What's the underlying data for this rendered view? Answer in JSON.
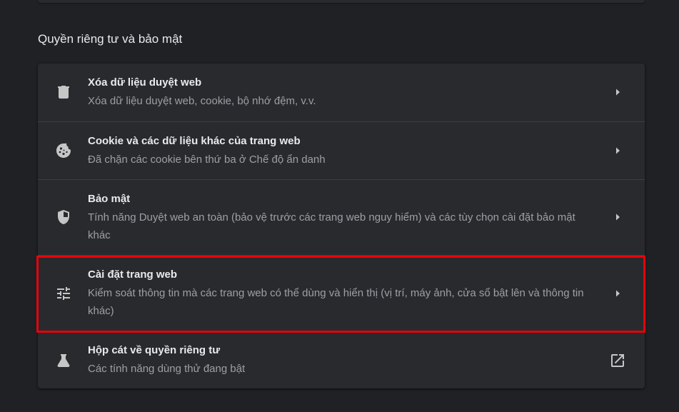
{
  "section": {
    "title": "Quyền riêng tư và bảo mật"
  },
  "rows": [
    {
      "title": "Xóa dữ liệu duyệt web",
      "subtitle": "Xóa dữ liệu duyệt web, cookie, bộ nhớ đệm, v.v.",
      "icon": "trash-icon",
      "trailing_icon": "chevron-right-icon"
    },
    {
      "title": "Cookie và các dữ liệu khác của trang web",
      "subtitle": "Đã chặn các cookie bên thứ ba ở Chế độ ẩn danh",
      "icon": "cookie-icon",
      "trailing_icon": "chevron-right-icon"
    },
    {
      "title": "Bảo mật",
      "subtitle": "Tính năng Duyệt web an toàn (bảo vệ trước các trang web nguy hiểm) và các tùy chọn cài đặt bảo mật khác",
      "icon": "shield-icon",
      "trailing_icon": "chevron-right-icon"
    },
    {
      "title": "Cài đặt trang web",
      "subtitle": "Kiểm soát thông tin mà các trang web có thể dùng và hiển thị (vị trí, máy ảnh, cửa sổ bật lên và thông tin khác)",
      "icon": "sliders-icon",
      "trailing_icon": "chevron-right-icon",
      "highlighted": true
    },
    {
      "title": "Hộp cát về quyền riêng tư",
      "subtitle": "Các tính năng dùng thử đang bật",
      "icon": "flask-icon",
      "trailing_icon": "open-in-new-icon"
    }
  ],
  "colors": {
    "background": "#202124",
    "card": "#292a2d",
    "divider": "#3c4043",
    "text_primary": "#e8eaed",
    "text_secondary": "#9aa0a6",
    "icon": "#c4c7c5",
    "highlight": "#e8000c"
  }
}
